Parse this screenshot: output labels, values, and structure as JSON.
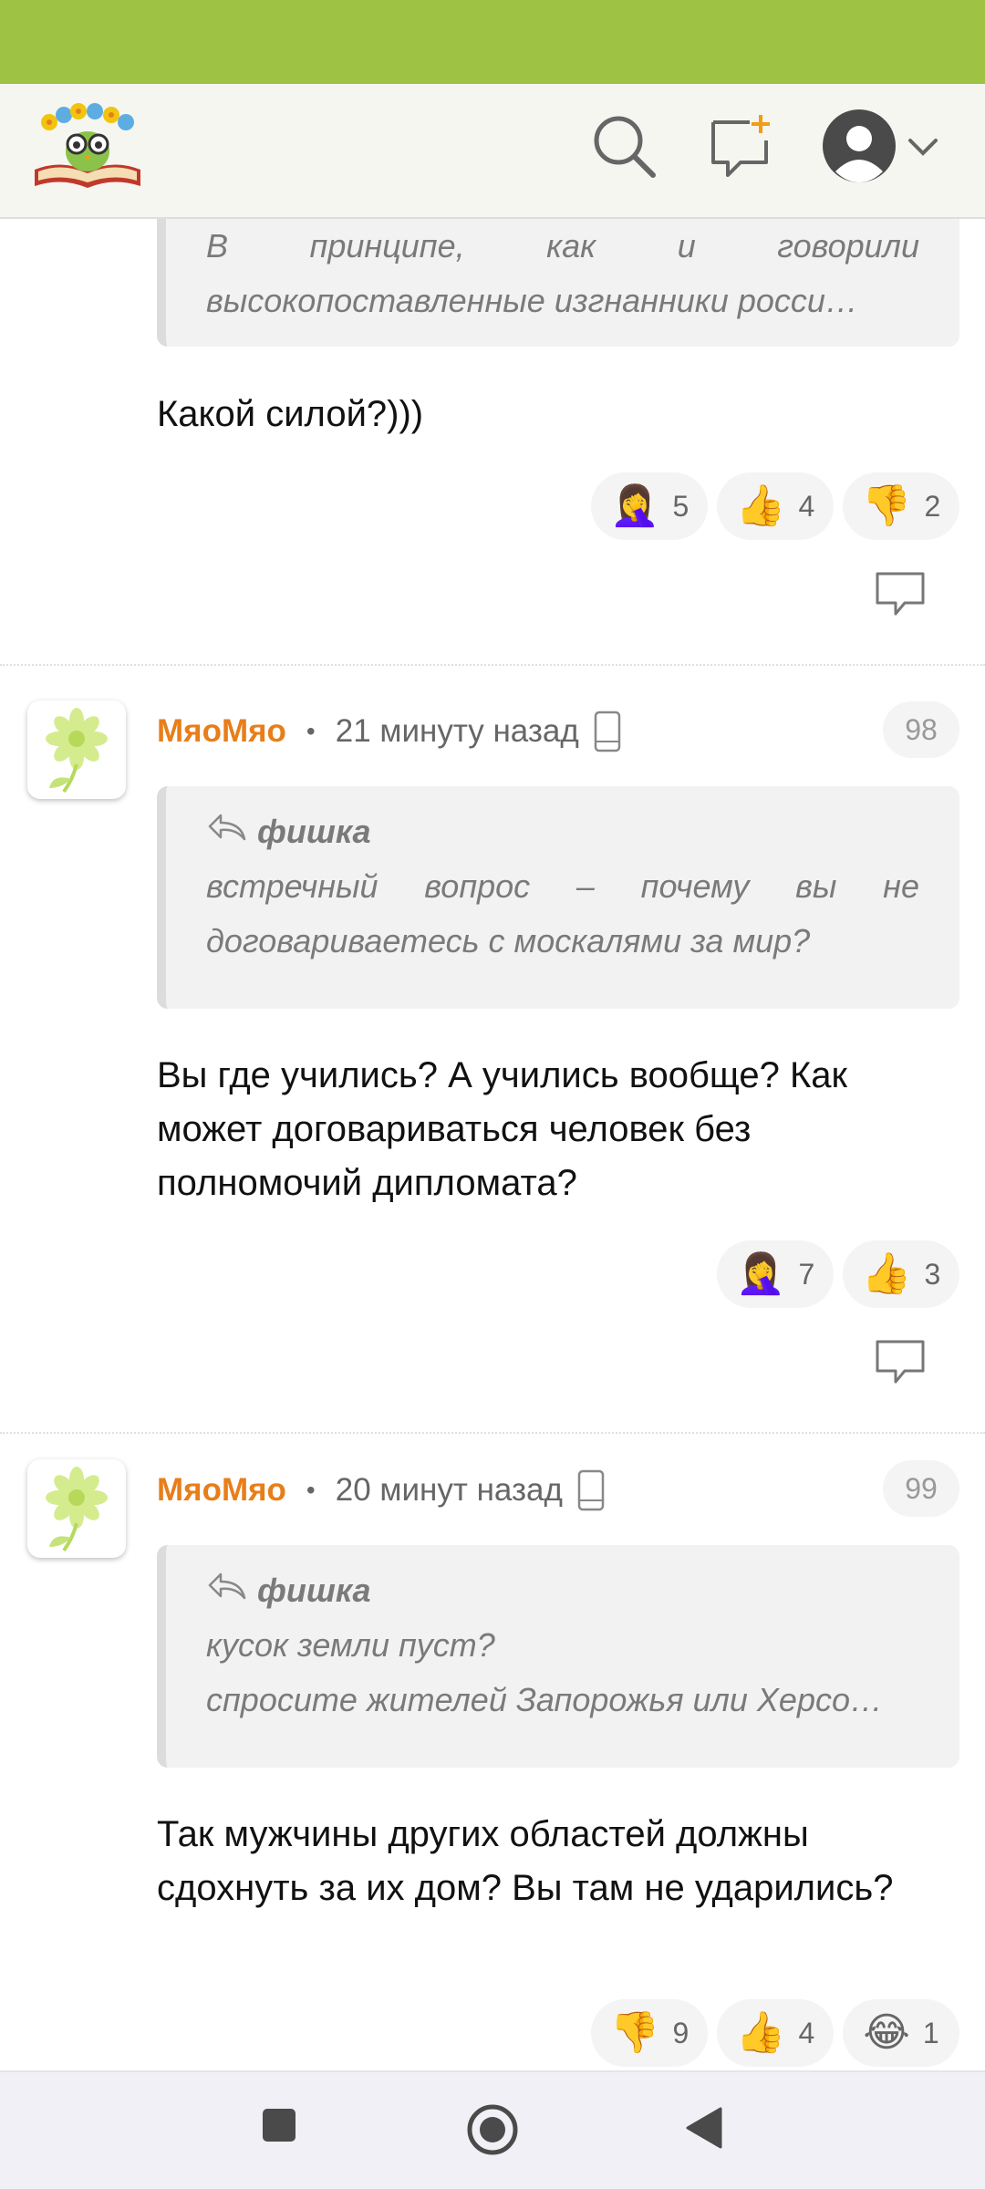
{
  "header": {
    "logo_icon": "owl-book-logo-icon",
    "search_icon": "search-icon",
    "new_message_icon": "new-message-icon",
    "profile_icon": "user-avatar-icon",
    "menu_icon": "chevron-down-icon",
    "accent_color": "#9dc244"
  },
  "comments": [
    {
      "quote": {
        "lines": [
          "В принципе, как и говорили",
          "высокопоставленные изгнанники росси…"
        ]
      },
      "text": "Какой силой?)))",
      "reactions": [
        {
          "emoji": "🤦‍♀️",
          "name": "facepalm",
          "count": "5"
        },
        {
          "emoji": "👍",
          "name": "thumbs-up",
          "count": "4"
        },
        {
          "emoji": "👎",
          "name": "thumbs-down",
          "count": "2"
        }
      ]
    },
    {
      "author": "МяоМяо",
      "time": "21 минуту назад",
      "number": "98",
      "quote": {
        "author": "фишка",
        "lines": [
          "встречный вопрос – почему вы не",
          "договариваетесь с москалями за мир?"
        ]
      },
      "text": "Вы где учились? А учились вообще? Как может договариваться человек без полномочий дипломата?",
      "reactions": [
        {
          "emoji": "🤦‍♀️",
          "name": "facepalm",
          "count": "7"
        },
        {
          "emoji": "👍",
          "name": "thumbs-up",
          "count": "3"
        }
      ]
    },
    {
      "author": "МяоМяо",
      "time": "20 минут назад",
      "number": "99",
      "quote": {
        "author": "фишка",
        "lines": [
          "кусок земли пуст?",
          "спросите жителей Запорожья или Херсо…"
        ]
      },
      "text": "Так мужчины других областей должны сдохнуть за их дом? Вы там не ударились?",
      "reactions": [
        {
          "emoji": "👎",
          "name": "thumbs-down",
          "count": "9"
        },
        {
          "emoji": "👍",
          "name": "thumbs-up",
          "count": "4"
        },
        {
          "emoji": "😂",
          "name": "laughing",
          "count": "1"
        }
      ]
    }
  ],
  "nav": {
    "recents_icon": "square-recents-icon",
    "home_icon": "circle-home-icon",
    "back_icon": "triangle-back-icon"
  }
}
